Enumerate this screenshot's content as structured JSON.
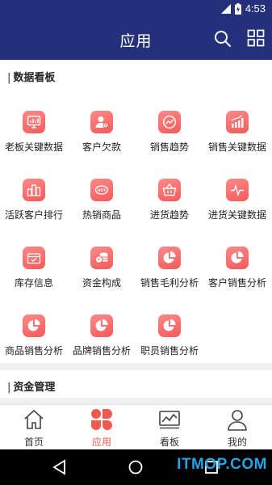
{
  "status_bar": {
    "time": "4:53"
  },
  "app_bar": {
    "title": "应用",
    "search_icon": "search-icon",
    "grid_icon": "grid-icon"
  },
  "sections": [
    {
      "title": "数据看板"
    },
    {
      "title": "资金管理"
    }
  ],
  "apps": [
    {
      "label": "老板关键数据",
      "icon": "monitor-chart-icon"
    },
    {
      "label": "客户欠款",
      "icon": "user-debt-icon"
    },
    {
      "label": "销售趋势",
      "icon": "trend-icon"
    },
    {
      "label": "销售关键数据",
      "icon": "bar-trend-icon"
    },
    {
      "label": "活跃客户排行",
      "icon": "ranking-icon"
    },
    {
      "label": "热销商品",
      "icon": "hot-tag-icon"
    },
    {
      "label": "进货趋势",
      "icon": "basket-icon"
    },
    {
      "label": "进货关键数据",
      "icon": "pulse-icon"
    },
    {
      "label": "库存信息",
      "icon": "inventory-icon"
    },
    {
      "label": "资金构成",
      "icon": "coins-icon"
    },
    {
      "label": "销售毛利分析",
      "icon": "pie-icon"
    },
    {
      "label": "客户销售分析",
      "icon": "pie-icon"
    },
    {
      "label": "商品销售分析",
      "icon": "pie-icon"
    },
    {
      "label": "品牌销售分析",
      "icon": "pie-icon"
    },
    {
      "label": "职员销售分析",
      "icon": "pie-icon"
    }
  ],
  "bottom_nav": [
    {
      "label": "首页",
      "icon": "home-icon",
      "active": false
    },
    {
      "label": "应用",
      "icon": "apps-flower-icon",
      "active": true
    },
    {
      "label": "看板",
      "icon": "dashboard-icon",
      "active": false
    },
    {
      "label": "我的",
      "icon": "person-icon",
      "active": false
    }
  ],
  "watermark": "ITMOP.COM",
  "colors": {
    "header": "#25307c",
    "accent": "#f0594c",
    "tile": "#f45a5a"
  }
}
